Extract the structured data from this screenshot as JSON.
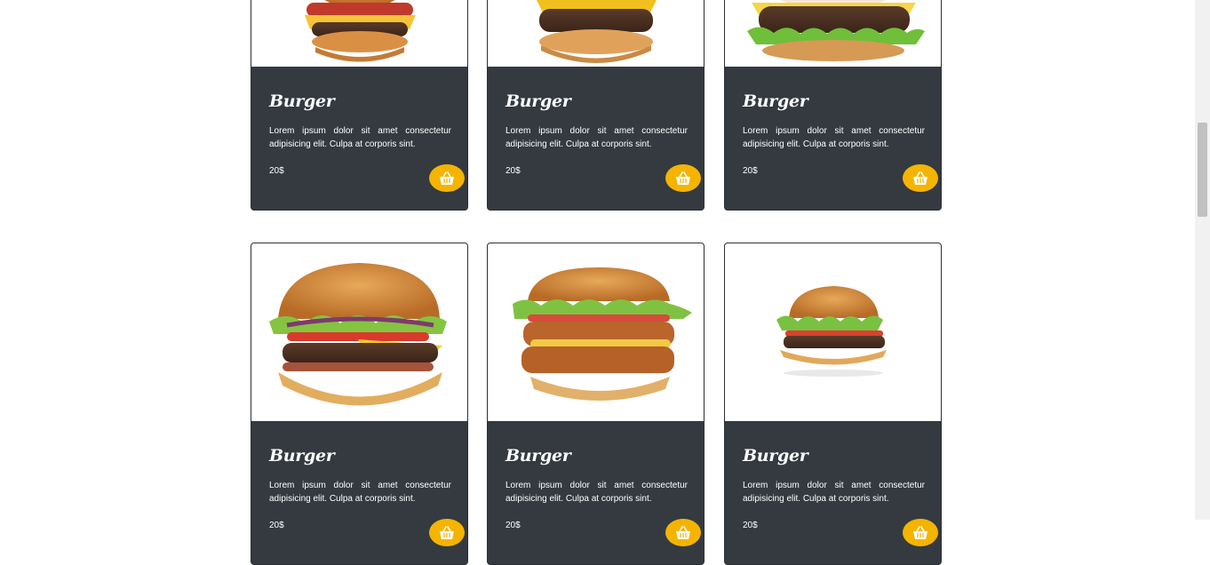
{
  "products": [
    {
      "title": "Burger",
      "description": "Lorem ipsum dolor sit amet consectetur adipisicing elit. Culpa at corporis sint.",
      "price": "20$"
    },
    {
      "title": "Burger",
      "description": "Lorem ipsum dolor sit amet consectetur adipisicing elit. Culpa at corporis sint.",
      "price": "20$"
    },
    {
      "title": "Burger",
      "description": "Lorem ipsum dolor sit amet consectetur adipisicing elit. Culpa at corporis sint.",
      "price": "20$"
    },
    {
      "title": "Burger",
      "description": "Lorem ipsum dolor sit amet consectetur adipisicing elit. Culpa at corporis sint.",
      "price": "20$"
    },
    {
      "title": "Burger",
      "description": "Lorem ipsum dolor sit amet consectetur adipisicing elit. Culpa at corporis sint.",
      "price": "20$"
    },
    {
      "title": "Burger",
      "description": "Lorem ipsum dolor sit amet consectetur adipisicing elit. Culpa at corporis sint.",
      "price": "20$"
    }
  ],
  "icons": {
    "cart": "basket-icon"
  },
  "colors": {
    "card_bg": "#343a40",
    "accent": "#f4b400",
    "text": "#ffffff"
  }
}
